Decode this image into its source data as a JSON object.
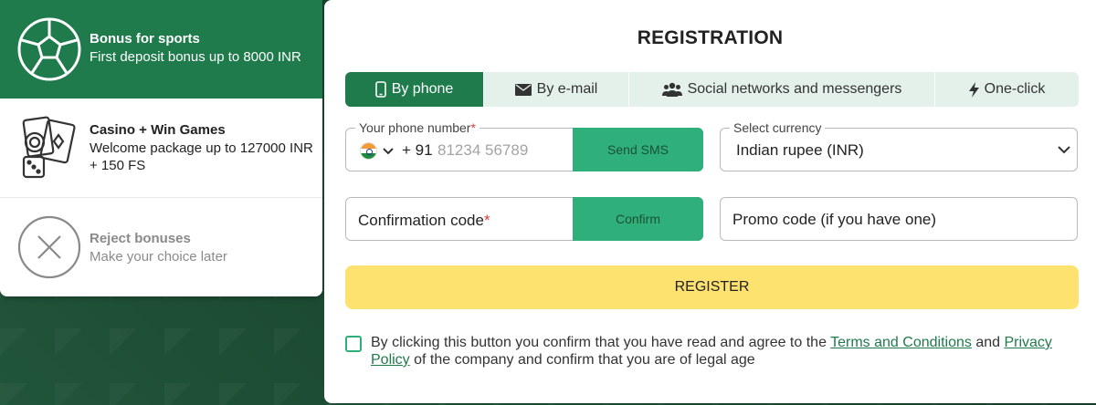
{
  "bonuses": [
    {
      "title": "Bonus for sports",
      "desc": "First deposit bonus up to 8000 INR",
      "icon": "soccer-ball-icon"
    },
    {
      "title": "Casino + Win Games",
      "desc": "Welcome package up to 127000 INR + 150 FS",
      "icon": "casino-cards-dice-icon"
    },
    {
      "title": "Reject bonuses",
      "desc": "Make your choice later",
      "icon": "close-circle-icon"
    }
  ],
  "registration": {
    "title": "REGISTRATION",
    "tabs": [
      {
        "label": "By phone",
        "icon": "phone-icon",
        "active": true
      },
      {
        "label": "By e-mail",
        "icon": "envelope-icon",
        "active": false
      },
      {
        "label": "Social networks and messengers",
        "icon": "people-icon",
        "active": false
      },
      {
        "label": "One-click",
        "icon": "lightning-icon",
        "active": false
      }
    ],
    "phone": {
      "label": "Your phone number",
      "required_mark": "*",
      "country_code": "+ 91",
      "placeholder": "81234 56789",
      "send_sms_label": "Send SMS"
    },
    "currency": {
      "label": "Select currency",
      "value": "Indian rupee (INR)"
    },
    "confirmation": {
      "label": "Confirmation code",
      "required_mark": "*",
      "button_label": "Confirm"
    },
    "promo": {
      "placeholder": "Promo code (if you have one)"
    },
    "register_label": "REGISTER",
    "agreement": {
      "text_before": "By clicking this button you confirm that you have read and agree to the ",
      "terms_link": "Terms and Conditions",
      "and": " and ",
      "privacy_link": "Privacy Policy",
      "text_after": " of the company and confirm that you are of legal age"
    }
  },
  "colors": {
    "brand_green": "#1f7a4c",
    "button_green": "#2fb07a",
    "register_yellow": "#fde270",
    "tab_bg": "#e3f1ea"
  }
}
